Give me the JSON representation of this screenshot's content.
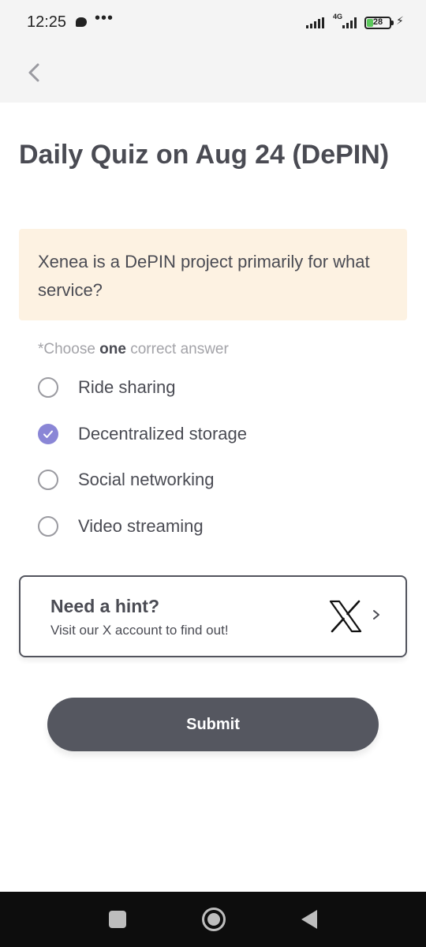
{
  "status_bar": {
    "time": "12:25",
    "dots": "•••",
    "network": "4G",
    "battery": "28",
    "battery_level": 0.28
  },
  "nav": {
    "back_icon": "chevron-left-icon"
  },
  "title": "Daily Quiz on Aug 24 (DePIN)",
  "question": "Xenea is a DePIN project primarily for what service?",
  "instruction": {
    "prefix": "*Choose ",
    "emphasis": "one",
    "suffix": " correct answer"
  },
  "options": [
    {
      "label": "Ride sharing",
      "selected": false
    },
    {
      "label": "Decentralized storage",
      "selected": true
    },
    {
      "label": "Social networking",
      "selected": false
    },
    {
      "label": "Video streaming",
      "selected": false
    }
  ],
  "hint": {
    "title": "Need a hint?",
    "subtitle": "Visit our X account to find out!",
    "icon": "x-logo-icon"
  },
  "submit_label": "Submit",
  "colors": {
    "accent": "#8a86d6",
    "question_bg": "#fdf2e2",
    "button_bg": "#555760"
  }
}
